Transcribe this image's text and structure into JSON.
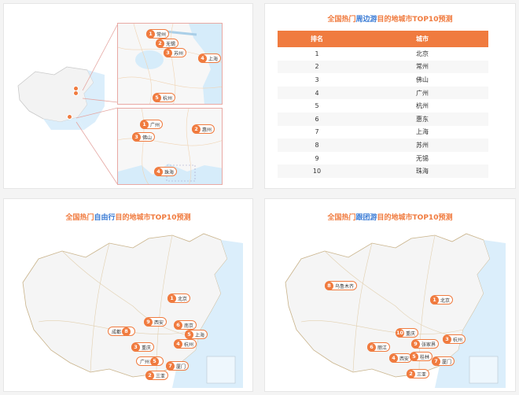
{
  "panels": {
    "zoom_map": {
      "pins_top": [
        {
          "n": "1",
          "label": "常州"
        },
        {
          "n": "2",
          "label": "无锡"
        },
        {
          "n": "3",
          "label": "苏州"
        },
        {
          "n": "4",
          "label": "上海"
        },
        {
          "n": "5",
          "label": "杭州"
        }
      ],
      "pins_bottom": [
        {
          "n": "1",
          "label": "广州"
        },
        {
          "n": "2",
          "label": "惠州"
        },
        {
          "n": "3",
          "label": "佛山"
        },
        {
          "n": "4",
          "label": "珠海"
        }
      ]
    },
    "nearby": {
      "title_pre": "全国热门",
      "title_hl": "周边游",
      "title_post": "目的地城市TOP10预测",
      "col_rank": "排名",
      "col_city": "城市",
      "rows": [
        {
          "rank": "1",
          "city": "北京"
        },
        {
          "rank": "2",
          "city": "常州"
        },
        {
          "rank": "3",
          "city": "佛山"
        },
        {
          "rank": "4",
          "city": "广州"
        },
        {
          "rank": "5",
          "city": "杭州"
        },
        {
          "rank": "6",
          "city": "惠东"
        },
        {
          "rank": "7",
          "city": "上海"
        },
        {
          "rank": "8",
          "city": "苏州"
        },
        {
          "rank": "9",
          "city": "无锡"
        },
        {
          "rank": "10",
          "city": "珠海"
        }
      ]
    },
    "independent": {
      "title_pre": "全国热门",
      "title_hl": "自由行",
      "title_post": "目的地城市TOP10预测",
      "pins": [
        {
          "n": "1",
          "label": "北京"
        },
        {
          "n": "9",
          "label": "西安"
        },
        {
          "n": "6",
          "label": "南京"
        },
        {
          "n": "8",
          "label": "成都"
        },
        {
          "n": "5",
          "label": "上海"
        },
        {
          "n": "3",
          "label": "重庆"
        },
        {
          "n": "4",
          "label": "杭州"
        },
        {
          "n": "5",
          "label": "广州"
        },
        {
          "n": "7",
          "label": "厦门"
        },
        {
          "n": "2",
          "label": "三亚"
        }
      ]
    },
    "group": {
      "title_pre": "全国热门",
      "title_hl": "跟团游",
      "title_post": "目的地城市TOP10预测",
      "pins": [
        {
          "n": "8",
          "label": "乌鲁木齐"
        },
        {
          "n": "1",
          "label": "北京"
        },
        {
          "n": "10",
          "label": "重庆"
        },
        {
          "n": "9",
          "label": "张家界"
        },
        {
          "n": "3",
          "label": "杭州"
        },
        {
          "n": "6",
          "label": "丽江"
        },
        {
          "n": "4",
          "label": "西安"
        },
        {
          "n": "5",
          "label": "桂林"
        },
        {
          "n": "7",
          "label": "厦门"
        },
        {
          "n": "2",
          "label": "三亚"
        }
      ]
    }
  }
}
